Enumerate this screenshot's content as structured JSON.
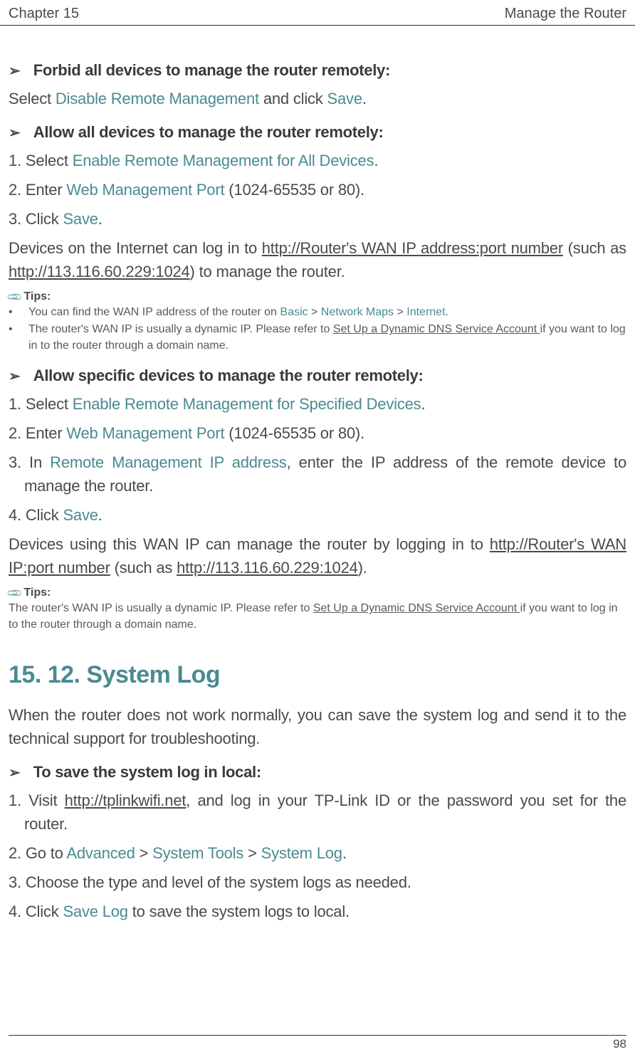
{
  "header": {
    "chapter": "Chapter 15",
    "title": "Manage the Router"
  },
  "section1": {
    "heading": "Forbid all devices to manage the router remotely:",
    "line_prefix": "Select ",
    "link1": "Disable Remote Management",
    "middle": " and click ",
    "link2": "Save",
    "suffix": "."
  },
  "section2": {
    "heading": "Allow all devices to manage the router remotely:",
    "step1_prefix": "1. Select ",
    "step1_link": "Enable Remote Management for All Devices",
    "step1_suffix": ".",
    "step2_prefix": "2. Enter ",
    "step2_link": "Web Management Port",
    "step2_suffix": " (1024-65535 or 80).",
    "step3_prefix": "3. Click ",
    "step3_link": "Save",
    "step3_suffix": ".",
    "para_prefix": "Devices on the Internet can log in to ",
    "para_link1": "http://Router's WAN IP address:port number",
    "para_middle": " (such as ",
    "para_link2": "http://113.116.60.229:1024",
    "para_suffix": ") to manage the router."
  },
  "tips1": {
    "label": "Tips:",
    "bullet1_prefix": "You can find the WAN IP address of the router on ",
    "bullet1_link1": "Basic",
    "bullet1_sep1": " > ",
    "bullet1_link2": "Network Maps",
    "bullet1_sep2": " > ",
    "bullet1_link3": "Internet",
    "bullet1_suffix": ".",
    "bullet2_prefix": "The router's WAN IP is usually a dynamic IP. Please refer to ",
    "bullet2_link": "Set Up a Dynamic DNS Service Account ",
    "bullet2_suffix": " if you want to log in to the router through a domain name."
  },
  "section3": {
    "heading": "Allow specific devices to manage the router remotely:",
    "step1_prefix": "1. Select ",
    "step1_link": "Enable Remote Management for Specified Devices",
    "step1_suffix": ".",
    "step2_prefix": "2. Enter ",
    "step2_link": "Web Management Port",
    "step2_suffix": " (1024-65535 or 80).",
    "step3_prefix": "3. In  ",
    "step3_link": "Remote  Management  IP  address",
    "step3_suffix": ",  enter  the  IP  address  of  the  remote  device  to manage the router.",
    "step4_prefix": "4. Click ",
    "step4_link": "Save",
    "step4_suffix": ".",
    "para_prefix": "Devices using this WAN IP can manage the router by logging in to ",
    "para_link1": "http://Router's WAN IP:port number",
    "para_middle": " (such as ",
    "para_link2": "http://113.116.60.229:1024",
    "para_suffix": ")."
  },
  "tips2": {
    "label": "Tips:",
    "text_prefix": "The router's WAN IP is usually a dynamic IP. Please refer to ",
    "text_link": "Set Up a Dynamic DNS Service Account ",
    "text_suffix": " if you want to log in to the router through a domain name."
  },
  "section4": {
    "heading": "15. 12. System Log",
    "intro": "When the router does not work normally, you can save the system log and send it to the technical support for troubleshooting.",
    "sub_heading": "To save the system log in local:",
    "step1_prefix": "1. Visit ",
    "step1_link": "http://tplinkwifi.net",
    "step1_suffix": ", and log in your TP-Link ID or the password you set for the router.",
    "step2_prefix": "2. Go to ",
    "step2_link1": "Advanced",
    "step2_sep1": " > ",
    "step2_link2": "System Tools",
    "step2_sep2": " > ",
    "step2_link3": "System Log",
    "step2_suffix": ".",
    "step3": "3. Choose the type and level of the system logs as needed.",
    "step4_prefix": "4. Click ",
    "step4_link": "Save Log",
    "step4_suffix": " to save the system logs to local."
  },
  "pageNumber": "98"
}
